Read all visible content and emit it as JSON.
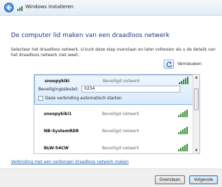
{
  "window": {
    "title": "Windows installeren"
  },
  "heading": "De computer lid maken van een draadloos netwerk",
  "instructions": "Selecteer het draadloos netwerk. U kunt deze stap overslaan en later voltooien als u de details van het draadloos netwerk niet weet.",
  "refresh_label": "Vernieuwen",
  "selected_network": {
    "name": "snoopykiki",
    "status": "Beveiligd netwerk",
    "key_label": "Beveiligingssleutel:",
    "key_value": "0234",
    "auto_connect_label": "Deze verbinding automatisch starten",
    "auto_connect_checked": false
  },
  "networks": [
    {
      "name": "snoopykiki1",
      "status": "Beveiligd netwerk",
      "signal": "strong"
    },
    {
      "name": "NB-SystemRD8",
      "status": "Beveiligd netwerk",
      "signal": "strong"
    },
    {
      "name": "BLW-54CW",
      "status": "Beveiligd netwerk",
      "signal": "strong"
    }
  ],
  "hidden_network_link": "Verbinding met een verborgen draadloos netwerk maken",
  "buttons": {
    "skip": "Overslaan",
    "next": "Volgende"
  },
  "colors": {
    "heading": "#1e3287",
    "signal": "#2e8b2e",
    "link": "#1a5fb4"
  }
}
